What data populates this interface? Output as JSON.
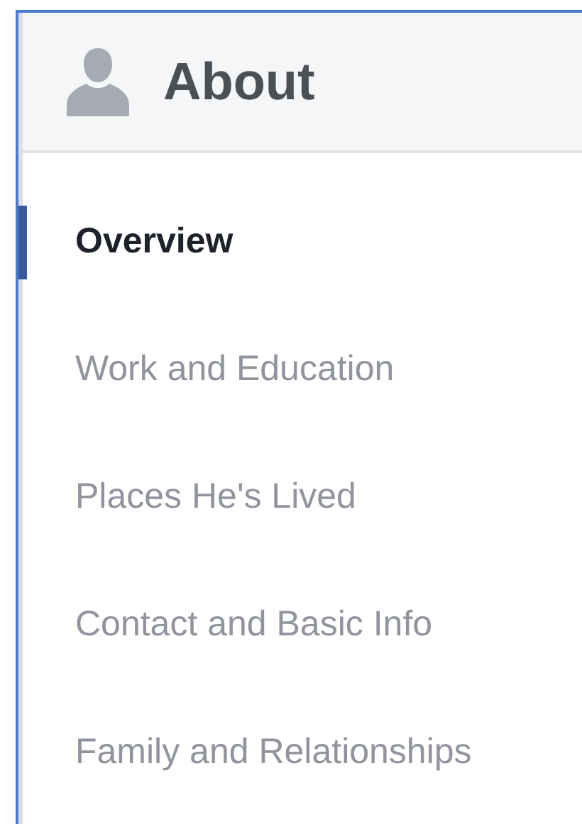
{
  "header": {
    "title": "About"
  },
  "nav": [
    {
      "label": "Overview",
      "selected": true
    },
    {
      "label": "Work and Education",
      "selected": false
    },
    {
      "label": "Places He's Lived",
      "selected": false
    },
    {
      "label": "Contact and Basic Info",
      "selected": false
    },
    {
      "label": "Family and Relationships",
      "selected": false
    }
  ]
}
